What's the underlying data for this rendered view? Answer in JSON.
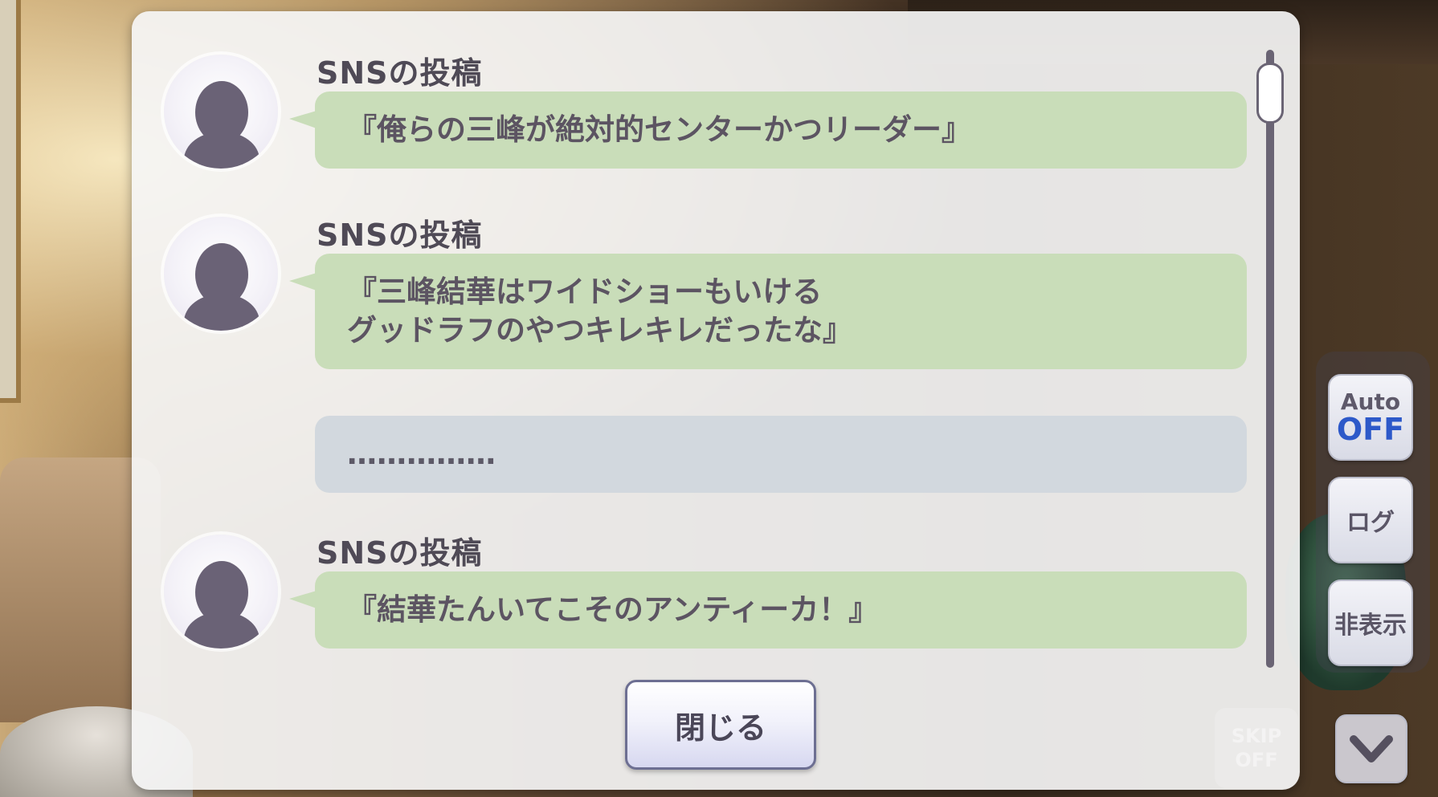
{
  "sns_log": {
    "posts": [
      {
        "speaker": "SNSの投稿",
        "text": "『俺らの三峰が絶対的センターかつリーダー』"
      },
      {
        "speaker": "SNSの投稿",
        "text": "『三峰結華はワイドショーもいける\nグッドラフのやつキレキレだったな』"
      },
      {
        "speaker": "",
        "text": "……………"
      },
      {
        "speaker": "SNSの投稿",
        "text": "『結華たんいてこそのアンティーカ！』"
      }
    ],
    "close_label": "閉じる"
  },
  "side_controls": {
    "auto_title": "Auto",
    "auto_state": "OFF",
    "log_label": "ログ",
    "hide_label": "非表示",
    "skip_badge_title": "SKIP",
    "skip_badge_state": "OFF"
  },
  "colors": {
    "bubble_green": "#c9ddb9",
    "bubble_grey": "#d2d8de",
    "auto_off_blue": "#2d59c9"
  },
  "icons": [
    "avatar-silhouette-icon",
    "chevron-down-icon"
  ]
}
